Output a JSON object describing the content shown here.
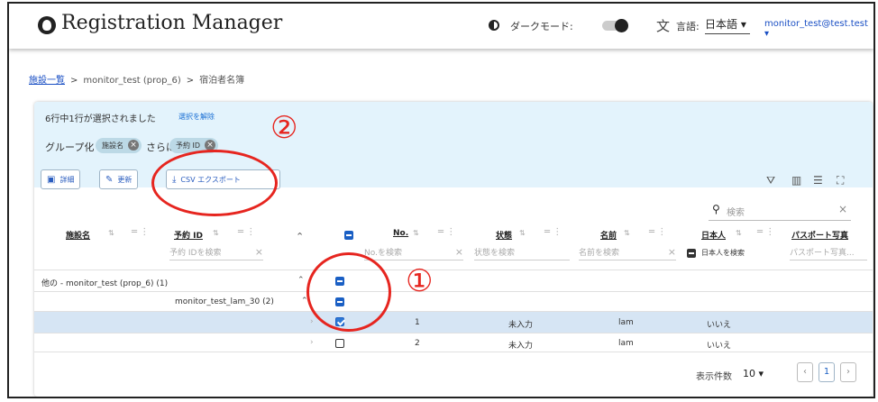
{
  "app": {
    "title": "Registration Manager",
    "dark_mode_label": "ダークモード:",
    "language_label": "言語:",
    "language_value": "日本語 ▾",
    "user": "monitor_test@test.test ▾"
  },
  "breadcrumb": {
    "root": "施設一覧",
    "facility": "monitor_test (prop_6)",
    "current": "宿泊者名簿"
  },
  "selection": {
    "text": "6行中1行が選択されました",
    "clear": "選択を解除"
  },
  "grouping": {
    "label": "グループ化",
    "chip1": "施設名",
    "then": "さらに",
    "chip2": "予約 ID"
  },
  "toolbar": {
    "detail": "詳細",
    "update": "更新",
    "csv_export": "CSV エクスポート"
  },
  "search": {
    "placeholder": "検索"
  },
  "columns": [
    {
      "label": "施設名"
    },
    {
      "label": "予約 ID",
      "filter": "予約 IDを検索"
    },
    {
      "label": "No.",
      "filter": "No.を検索"
    },
    {
      "label": "状態",
      "filter": "状態を検索"
    },
    {
      "label": "名前",
      "filter": "名前を検索"
    },
    {
      "label": "日本人",
      "filter": "日本人を検索"
    },
    {
      "label": "パスポート写真",
      "filter": "パスポート写真..."
    }
  ],
  "groups": {
    "level1": "他の - monitor_test (prop_6) (1)",
    "level2": "monitor_test_lam_30 (2)"
  },
  "rows": [
    {
      "no": "1",
      "status": "未入力",
      "name": "lam",
      "japanese": "いいえ"
    },
    {
      "no": "2",
      "status": "未入力",
      "name": "lam",
      "japanese": "いいえ"
    }
  ],
  "footer": {
    "rows_label": "表示件数",
    "rows_value": "10 ▾",
    "page": "1"
  },
  "annotations": {
    "one": "①",
    "two": "②"
  }
}
